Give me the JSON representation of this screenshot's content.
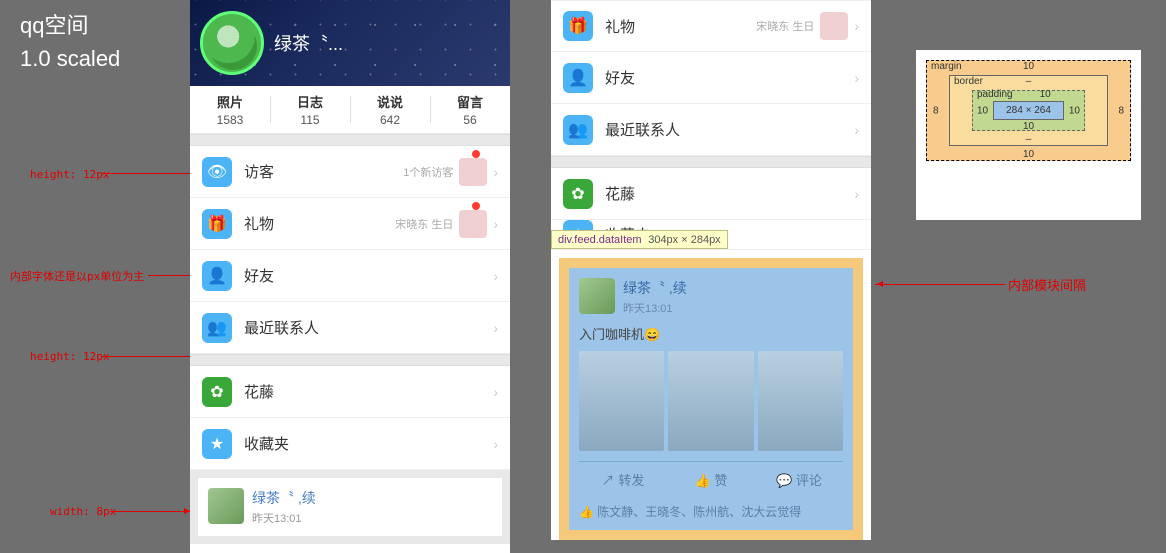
{
  "titleBlock": {
    "line1": "qq空间",
    "line2": "1.0  scaled"
  },
  "annotations": {
    "height12a": "height: 12px",
    "height12b": "height: 12px",
    "width8": "width: 8px",
    "innerFont": "内部字体还是以px单位为主",
    "tick12a": "12",
    "tick12b": "12",
    "tick8": "8",
    "innerModule": "内部模块间隔"
  },
  "header": {
    "name": "绿茶〝..."
  },
  "stats": [
    {
      "label": "照片",
      "value": "1583"
    },
    {
      "label": "日志",
      "value": "115"
    },
    {
      "label": "说说",
      "value": "642"
    },
    {
      "label": "留言",
      "value": "56"
    }
  ],
  "rows1": [
    {
      "icon": "eye",
      "color": "i-blue",
      "label": "访客",
      "meta": "1个新访客",
      "thumb": true,
      "dot": true,
      "glyph": "👁"
    },
    {
      "icon": "gift",
      "color": "i-blue",
      "label": "礼物",
      "meta": "宋晓东 生日",
      "thumb": true,
      "dot": true,
      "glyph": "🎁"
    },
    {
      "icon": "friend",
      "color": "i-blue",
      "label": "好友",
      "meta": "",
      "thumb": false,
      "dot": false,
      "glyph": "👤"
    },
    {
      "icon": "recent",
      "color": "i-blue",
      "label": "最近联系人",
      "meta": "",
      "thumb": false,
      "dot": false,
      "glyph": "👥"
    }
  ],
  "rows1b": [
    {
      "icon": "flower",
      "color": "i-dgreen",
      "label": "花藤",
      "glyph": "✿"
    },
    {
      "icon": "fav",
      "color": "i-blue",
      "label": "收藏夹",
      "glyph": "★"
    }
  ],
  "feed1": {
    "name": "绿茶〝  ,续",
    "time": "昨天13:01"
  },
  "rows2top": [
    {
      "icon": "gift",
      "color": "i-blue",
      "label": "礼物",
      "meta": "宋晓东 生日",
      "thumb": true,
      "glyph": "🎁"
    },
    {
      "icon": "friend",
      "color": "i-blue",
      "label": "好友",
      "glyph": "👤"
    },
    {
      "icon": "recent",
      "color": "i-blue",
      "label": "最近联系人",
      "glyph": "👥"
    }
  ],
  "rows2mid": [
    {
      "icon": "flower",
      "color": "i-dgreen",
      "label": "花藤",
      "glyph": "✿"
    },
    {
      "icon": "fav",
      "color": "i-blue",
      "label": "收藏夹",
      "glyph": "★"
    }
  ],
  "tooltip": {
    "selector": "div.feed.dataItem",
    "dims": "304px × 284px"
  },
  "feed2": {
    "name": "绿茶〝  ,续",
    "time": "昨天13:01",
    "body": "入门咖啡机😄",
    "actions": [
      {
        "icon": "↗",
        "label": "转发"
      },
      {
        "icon": "👍",
        "label": "赞"
      },
      {
        "icon": "💬",
        "label": "评论"
      }
    ],
    "likes_icon": "👍",
    "likes": "陈文静、王晓冬、陈州航、沈大云觉得"
  },
  "boxModel": {
    "marginLabel": "margin",
    "borderLabel": "border",
    "paddingLabel": "padding",
    "marginTop": "10",
    "marginRight": "8",
    "marginBottom": "10",
    "marginLeft": "8",
    "borderTop": "–",
    "borderBottom": "–",
    "paddingTop": "10",
    "paddingRight": "10",
    "paddingBottom": "10",
    "paddingLeft": "10",
    "content": "284 × 264"
  }
}
